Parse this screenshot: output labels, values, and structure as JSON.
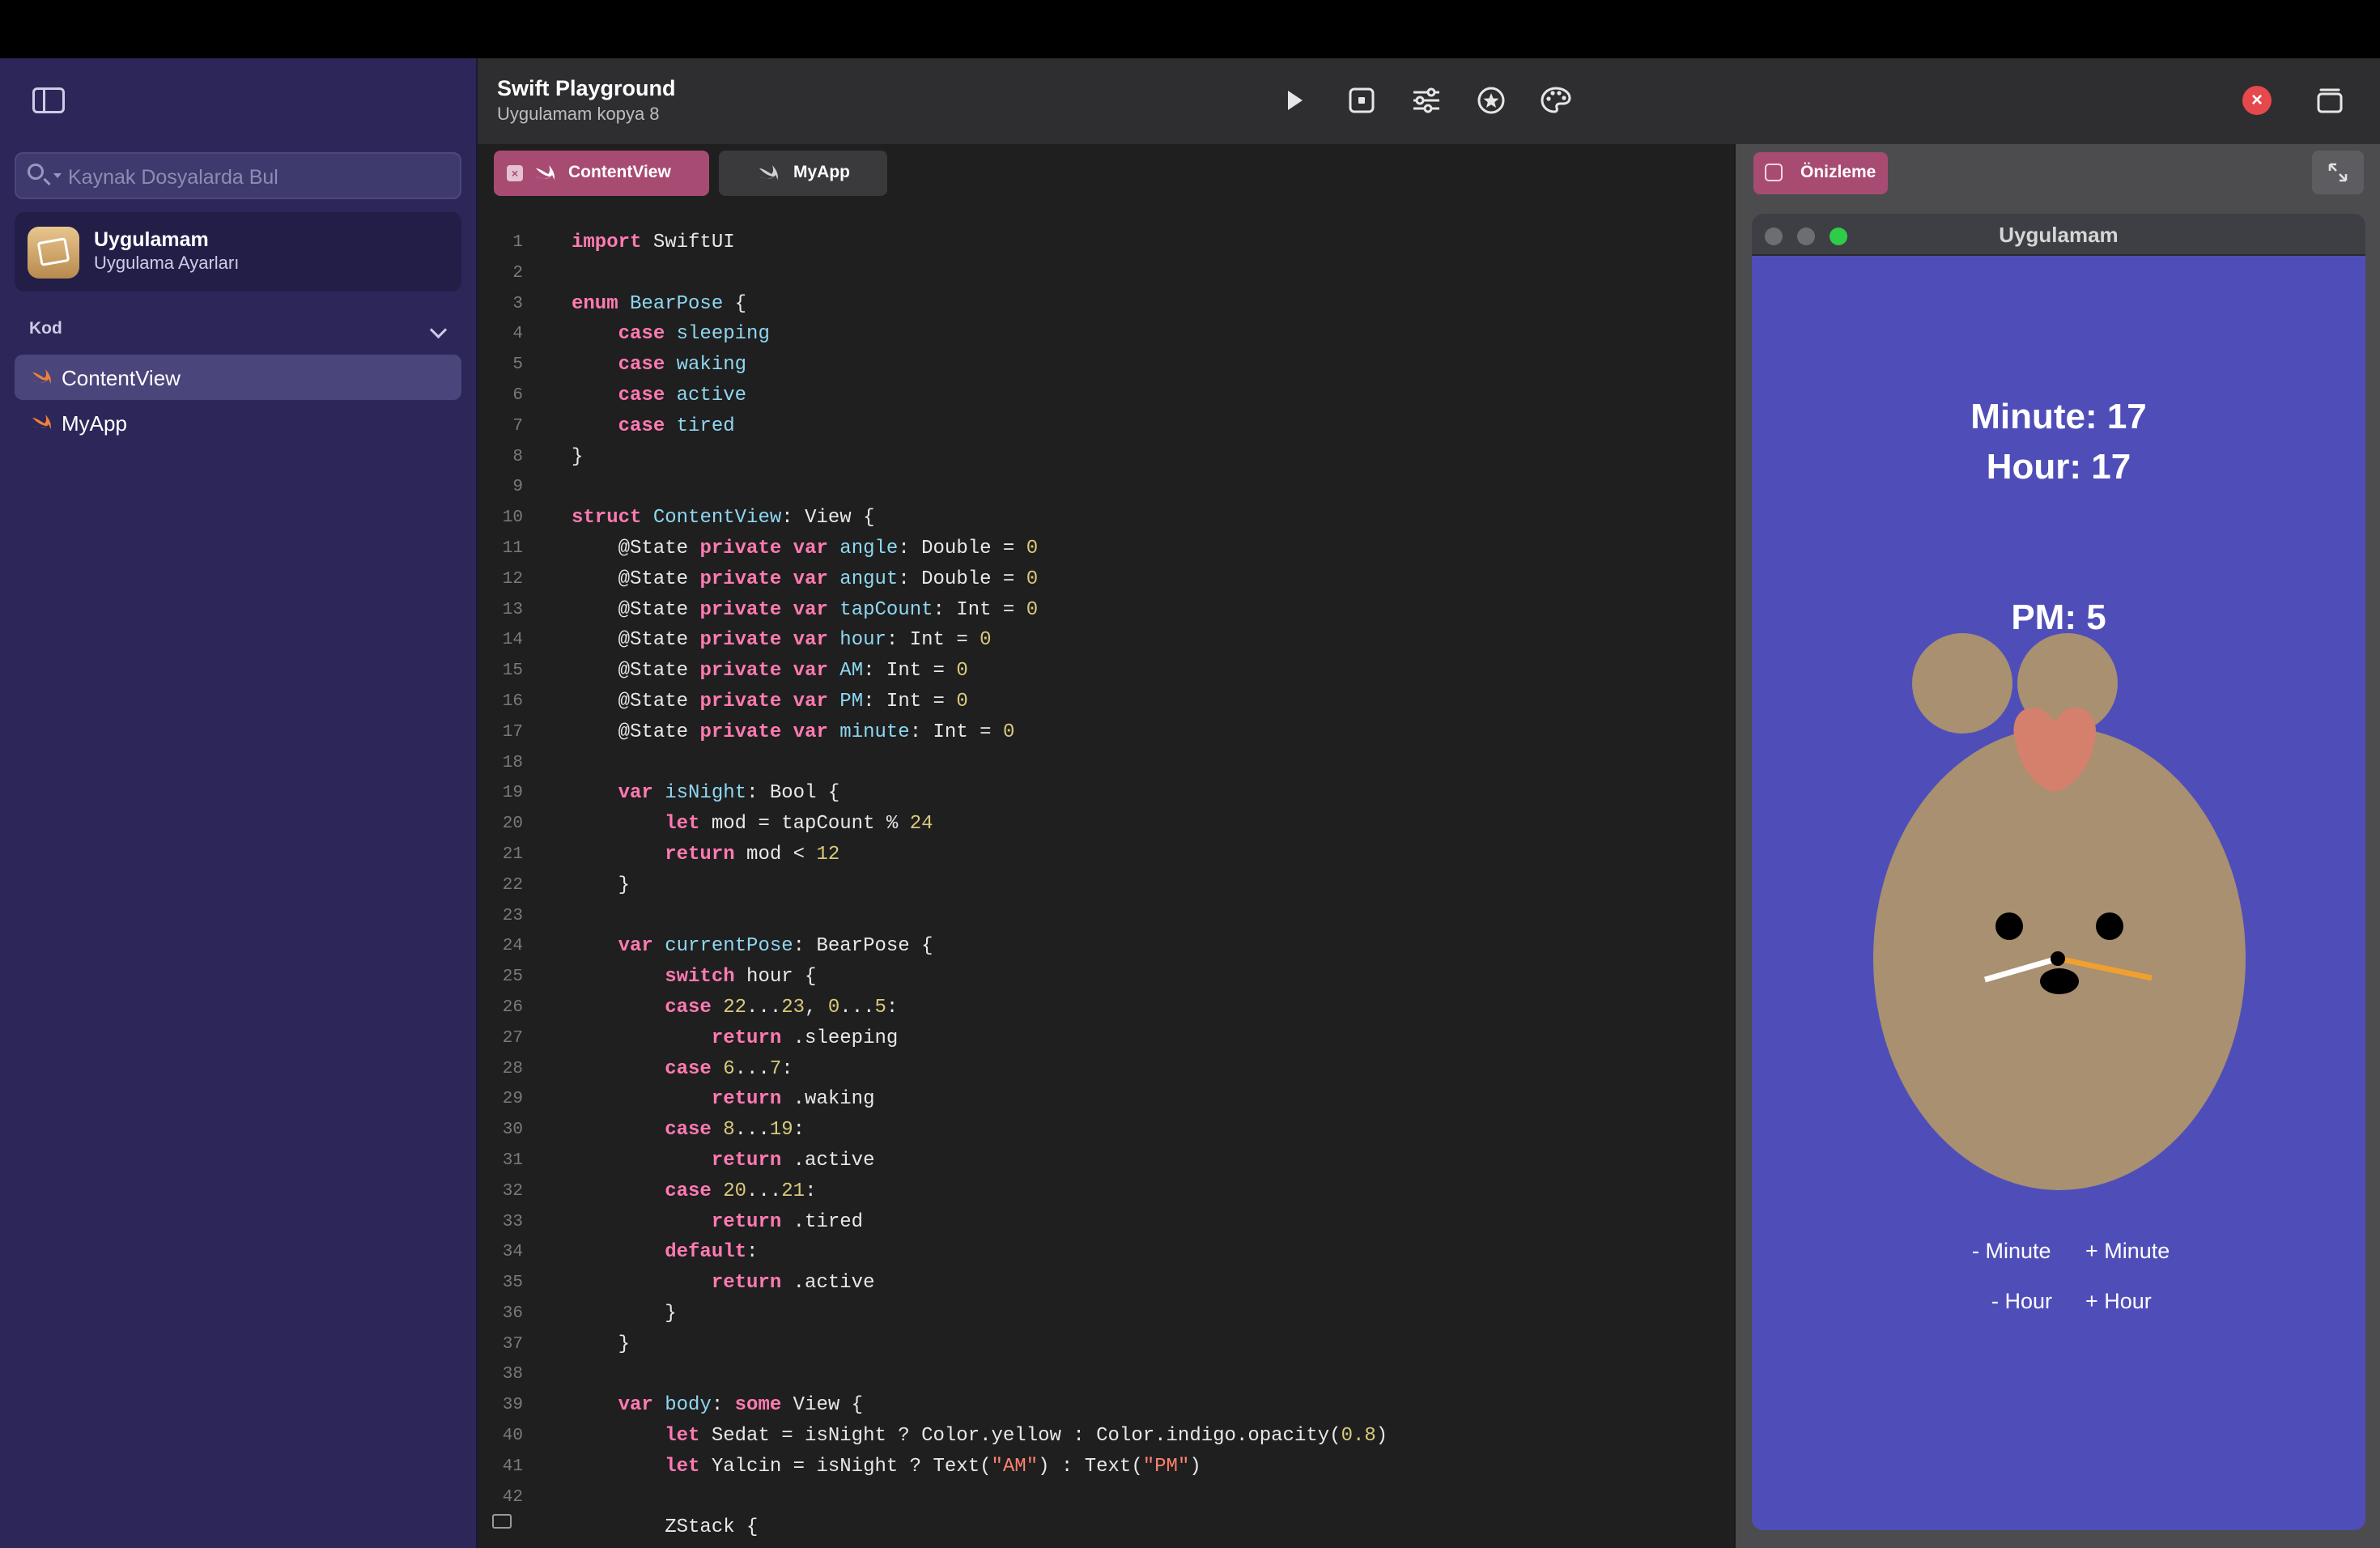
{
  "sidebar": {
    "search_placeholder": "Kaynak Dosyalarda Bul",
    "app": {
      "name": "Uygulamam",
      "subtitle": "Uygulama Ayarları"
    },
    "section_label": "Kod",
    "items": [
      {
        "label": "ContentView",
        "selected": true
      },
      {
        "label": "MyApp",
        "selected": false
      }
    ]
  },
  "header": {
    "title": "Swift Playground",
    "subtitle": "Uygulamam kopya 8",
    "tools": [
      "play-icon",
      "stop-icon",
      "sliders-icon",
      "star-icon",
      "palette-icon"
    ]
  },
  "editor": {
    "tabs": [
      {
        "label": "ContentView",
        "active": true
      },
      {
        "label": "MyApp",
        "active": false
      }
    ],
    "lines": [
      {
        "n": "1",
        "h": "<span class='k'>import</span> SwiftUI"
      },
      {
        "n": "2",
        "h": ""
      },
      {
        "n": "3",
        "h": "<span class='k'>enum</span> <span class='t'>BearPose</span> {"
      },
      {
        "n": "4",
        "h": "    <span class='k'>case</span> <span class='t'>sleeping</span>"
      },
      {
        "n": "5",
        "h": "    <span class='k'>case</span> <span class='t'>waking</span>"
      },
      {
        "n": "6",
        "h": "    <span class='k'>case</span> <span class='t'>active</span>"
      },
      {
        "n": "7",
        "h": "    <span class='k'>case</span> <span class='t'>tired</span>"
      },
      {
        "n": "8",
        "h": "}"
      },
      {
        "n": "9",
        "h": ""
      },
      {
        "n": "10",
        "h": "<span class='k'>struct</span> <span class='t'>ContentView</span>: View {"
      },
      {
        "n": "11",
        "h": "    @State <span class='k'>private</span> <span class='k'>var</span> <span class='t'>angle</span>: Double = <span class='n'>0</span>"
      },
      {
        "n": "12",
        "h": "    @State <span class='k'>private</span> <span class='k'>var</span> <span class='t'>angut</span>: Double = <span class='n'>0</span>"
      },
      {
        "n": "13",
        "h": "    @State <span class='k'>private</span> <span class='k'>var</span> <span class='t'>tapCount</span>: Int = <span class='n'>0</span>"
      },
      {
        "n": "14",
        "h": "    @State <span class='k'>private</span> <span class='k'>var</span> <span class='t'>hour</span>: Int = <span class='n'>0</span>"
      },
      {
        "n": "15",
        "h": "    @State <span class='k'>private</span> <span class='k'>var</span> <span class='t'>AM</span>: Int = <span class='n'>0</span>"
      },
      {
        "n": "16",
        "h": "    @State <span class='k'>private</span> <span class='k'>var</span> <span class='t'>PM</span>: Int = <span class='n'>0</span>"
      },
      {
        "n": "17",
        "h": "    @State <span class='k'>private</span> <span class='k'>var</span> <span class='t'>minute</span>: Int = <span class='n'>0</span>"
      },
      {
        "n": "18",
        "h": ""
      },
      {
        "n": "19",
        "h": "    <span class='k'>var</span> <span class='t'>isNight</span>: Bool {"
      },
      {
        "n": "20",
        "h": "        <span class='k'>let</span> mod = tapCount % <span class='n'>24</span>"
      },
      {
        "n": "21",
        "h": "        <span class='k'>return</span> mod < <span class='n'>12</span>"
      },
      {
        "n": "22",
        "h": "    }"
      },
      {
        "n": "23",
        "h": ""
      },
      {
        "n": "24",
        "h": "    <span class='k'>var</span> <span class='t'>currentPose</span>: BearPose {"
      },
      {
        "n": "25",
        "h": "        <span class='k'>switch</span> hour {"
      },
      {
        "n": "26",
        "h": "        <span class='k'>case</span> <span class='n'>22</span>...<span class='n'>23</span>, <span class='n'>0</span>...<span class='n'>5</span>:"
      },
      {
        "n": "27",
        "h": "            <span class='k'>return</span> .sleeping"
      },
      {
        "n": "28",
        "h": "        <span class='k'>case</span> <span class='n'>6</span>...<span class='n'>7</span>:"
      },
      {
        "n": "29",
        "h": "            <span class='k'>return</span> .waking"
      },
      {
        "n": "30",
        "h": "        <span class='k'>case</span> <span class='n'>8</span>...<span class='n'>19</span>:"
      },
      {
        "n": "31",
        "h": "            <span class='k'>return</span> .active"
      },
      {
        "n": "32",
        "h": "        <span class='k'>case</span> <span class='n'>20</span>...<span class='n'>21</span>:"
      },
      {
        "n": "33",
        "h": "            <span class='k'>return</span> .tired"
      },
      {
        "n": "34",
        "h": "        <span class='k'>default</span>:"
      },
      {
        "n": "35",
        "h": "            <span class='k'>return</span> .active"
      },
      {
        "n": "36",
        "h": "        }"
      },
      {
        "n": "37",
        "h": "    }"
      },
      {
        "n": "38",
        "h": ""
      },
      {
        "n": "39",
        "h": "    <span class='k'>var</span> <span class='t'>body</span>: <span class='k'>some</span> View {"
      },
      {
        "n": "40",
        "h": "        <span class='k'>let</span> Sedat = isNight ? Color.yellow : Color.indigo.opacity(<span class='n'>0.8</span>)"
      },
      {
        "n": "41",
        "h": "        <span class='k'>let</span> Yalcin = isNight ? Text(<span class='s'>\"AM\"</span>) : Text(<span class='s'>\"PM\"</span>)"
      },
      {
        "n": "42",
        "h": ""
      },
      {
        "n": "",
        "h": "        ZStack {"
      }
    ]
  },
  "preview": {
    "tab_label": "Önizleme",
    "window_title": "Uygulamam",
    "minute_text": "Minute: 17",
    "hour_text": "Hour: 17",
    "pm_text": "PM: 5",
    "minus_minute": "- Minute",
    "plus_minute": "+ Minute",
    "minus_hour": "- Hour",
    "plus_hour": "+ Hour",
    "colors": {
      "window_bg": "#4f4eb9",
      "bear_body": "#a89070",
      "bear_heart": "#d4806c",
      "minute_hand": "#ffffff",
      "hour_hand": "#f0a030"
    }
  },
  "colors": {
    "accent": "#a84b72",
    "sidebar_bg": "#2c2758",
    "editor_bg": "#1f1f1f"
  }
}
